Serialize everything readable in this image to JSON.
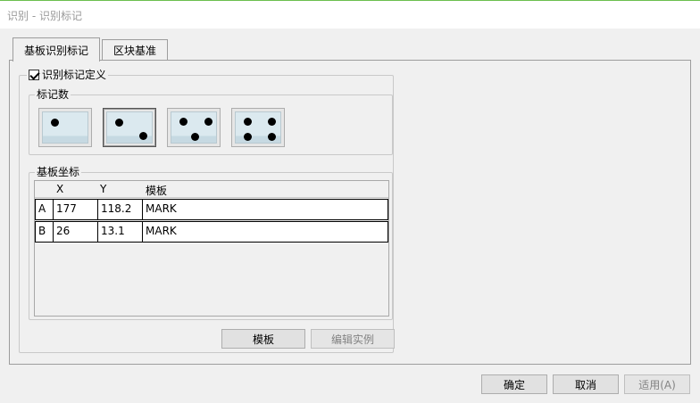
{
  "window": {
    "title": "识别 - 识别标记"
  },
  "tabs": [
    {
      "label": "基板识别标记",
      "active": true
    },
    {
      "label": "区块基准",
      "active": false
    }
  ],
  "mark_definition": {
    "checkbox_label": "识别标记定义",
    "checked": true
  },
  "mark_count": {
    "legend": "标记数",
    "options": [
      {
        "name": "one-mark",
        "dots": 1,
        "selected": false
      },
      {
        "name": "two-marks",
        "dots": 2,
        "selected": true
      },
      {
        "name": "three-marks",
        "dots": 3,
        "selected": false
      },
      {
        "name": "four-marks",
        "dots": 4,
        "selected": false
      }
    ]
  },
  "board_coords": {
    "legend": "基板坐标",
    "columns": [
      "X",
      "Y",
      "模板"
    ],
    "rows": [
      {
        "id": "A",
        "x": "177",
        "y": "118.2",
        "template": "MARK"
      },
      {
        "id": "B",
        "x": "26",
        "y": "13.1",
        "template": "MARK"
      }
    ]
  },
  "panel_buttons": {
    "template": "模板",
    "edit_example": "编辑实例"
  },
  "dialog_buttons": {
    "ok": "确定",
    "cancel": "取消",
    "apply": "适用(A)"
  },
  "colors": {
    "title_accent": "#6bbf4e",
    "mark_face": "#dbe9ef"
  }
}
